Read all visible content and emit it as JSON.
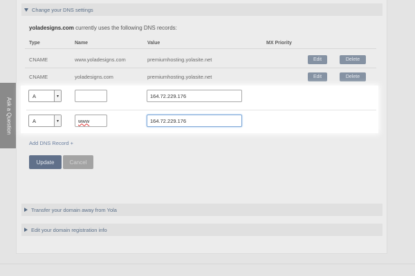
{
  "feedback_tab": {
    "label": "Ask a Question"
  },
  "sections": {
    "dns": {
      "title": "Change your DNS settings"
    },
    "transfer": {
      "title": "Transfer your domain away from Yola"
    },
    "registration": {
      "title": "Edit your domain registration info"
    }
  },
  "intro": {
    "domain": "yoladesigns.com",
    "text": " currently uses the following DNS records:"
  },
  "table": {
    "headers": {
      "type": "Type",
      "name": "Name",
      "value": "Value",
      "mx": "MX Priority"
    },
    "rows": [
      {
        "type": "CNAME",
        "name": "www.yoladesigns.com",
        "value": "premiumhosting.yolasite.net",
        "edit": "Edit",
        "delete": "Delete"
      },
      {
        "type": "CNAME",
        "name": "yoladesigns.com",
        "value": "premiumhosting.yolasite.net",
        "edit": "Edit",
        "delete": "Delete"
      }
    ]
  },
  "new_records": [
    {
      "type": "A",
      "name": "",
      "value": "164.72.229.176"
    },
    {
      "type": "A",
      "name": "www",
      "value": "164.72.229.176"
    }
  ],
  "add_record_label": "Add DNS Record +",
  "buttons": {
    "update": "Update",
    "cancel": "Cancel"
  }
}
